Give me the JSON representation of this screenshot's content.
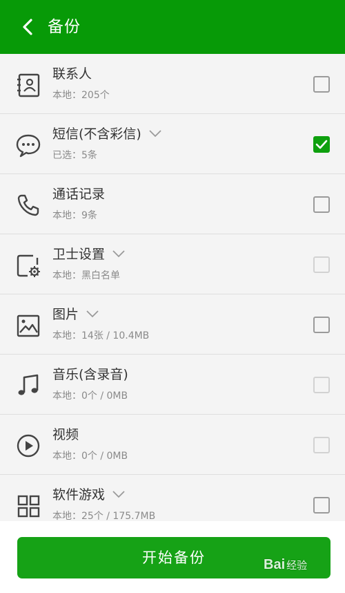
{
  "header": {
    "title": "备份"
  },
  "items": [
    {
      "title": "联系人",
      "sub": "本地：205个",
      "icon": "contacts-icon",
      "dropdown": false,
      "checkbox": "unchecked"
    },
    {
      "title": "短信(不含彩信)",
      "sub": "已选：5条",
      "icon": "message-icon",
      "dropdown": true,
      "checkbox": "checked"
    },
    {
      "title": "通话记录",
      "sub": "本地：9条",
      "icon": "phone-icon",
      "dropdown": false,
      "checkbox": "unchecked"
    },
    {
      "title": "卫士设置",
      "sub": "本地：黑白名单",
      "icon": "device-settings-icon",
      "dropdown": true,
      "checkbox": "disabled"
    },
    {
      "title": "图片",
      "sub": "本地：14张 / 10.4MB",
      "icon": "image-icon",
      "dropdown": true,
      "checkbox": "unchecked"
    },
    {
      "title": "音乐(含录音)",
      "sub": "本地：0个 / 0MB",
      "icon": "music-icon",
      "dropdown": false,
      "checkbox": "disabled"
    },
    {
      "title": "视频",
      "sub": "本地：0个 / 0MB",
      "icon": "video-icon",
      "dropdown": false,
      "checkbox": "disabled"
    },
    {
      "title": "软件游戏",
      "sub": "本地：25个 / 175.7MB",
      "icon": "apps-icon",
      "dropdown": true,
      "checkbox": "unchecked"
    }
  ],
  "footer": {
    "button_label": "开始备份"
  },
  "watermark": {
    "brand": "Bai",
    "suffix": "经验"
  },
  "colors": {
    "header": "#079a07",
    "button": "#16a216",
    "check": "#0ea00e"
  }
}
